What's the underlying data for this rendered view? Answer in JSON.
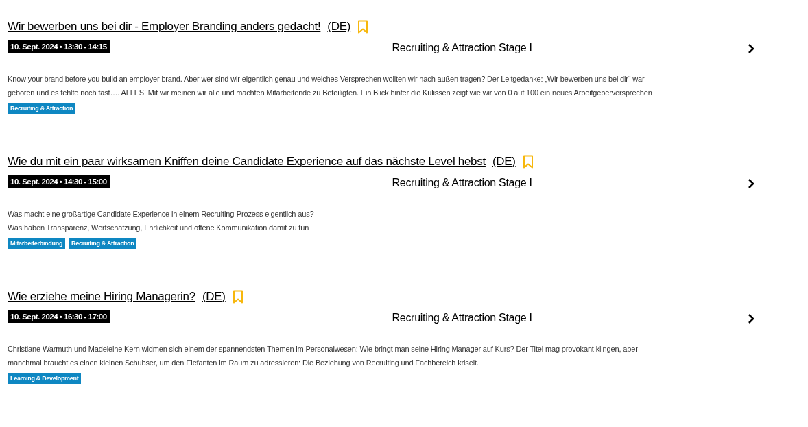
{
  "sessions": [
    {
      "title": "Wir bewerben uns bei dir - Employer Branding anders gedacht!",
      "language": "(DE)",
      "bookmarked": false,
      "date": "10. Sept. 2024 • 13:30 - 14:15",
      "stage": "Recruiting & Attraction Stage I",
      "description_lines": [
        "Know your brand before you build an employer brand. Aber wer sind wir eigentlich genau und welches Versprechen wollten wir nach außen tragen? Der Leitgedanke: „Wir bewerben uns bei dir“ war",
        "geboren und es fehlte noch fast…. ALLES! Mit wir meinen wir alle und machten Mitarbeitende zu Beteiligten. Ein Blick hinter die Kulissen zeigt wie wir von 0 auf 100 ein neues Arbeitgeberversprechen"
      ],
      "tags": [
        "Recruiting & Attraction"
      ]
    },
    {
      "title": "Wie du mit ein paar wirksamen Kniffen deine Candidate Experience auf das nächste Level hebst",
      "language": "(DE)",
      "bookmarked": false,
      "date": "10. Sept. 2024 • 14:30 - 15:00",
      "stage": "Recruiting & Attraction Stage I",
      "description_lines": [
        "Was macht eine großartige Candidate Experience in einem Recruiting-Prozess eigentlich aus?",
        "Was haben Transparenz, Wertschätzung, Ehrlichkeit und offene Kommunikation damit zu tun"
      ],
      "tags": [
        "Mitarbeiterbindung",
        "Recruiting & Attraction"
      ]
    },
    {
      "title": "Wie erziehe meine Hiring Managerin?",
      "language": "(DE)",
      "bookmarked": false,
      "date": "10. Sept. 2024 • 16:30 - 17:00",
      "stage": "Recruiting & Attraction Stage I",
      "description_lines": [
        "Christiane Warmuth und Madeleine Kern widmen sich einem der spannendsten Themen im Personalwesen: Wie bringt man seine Hiring Manager auf Kurs? Der Titel mag provokant klingen, aber",
        "manchmal braucht es einen kleinen Schubser, um den Elefanten im Raum zu adressieren: Die Beziehung von Recruiting und Fachbereich kriselt."
      ],
      "tags": [
        "Learning & Development"
      ]
    }
  ]
}
